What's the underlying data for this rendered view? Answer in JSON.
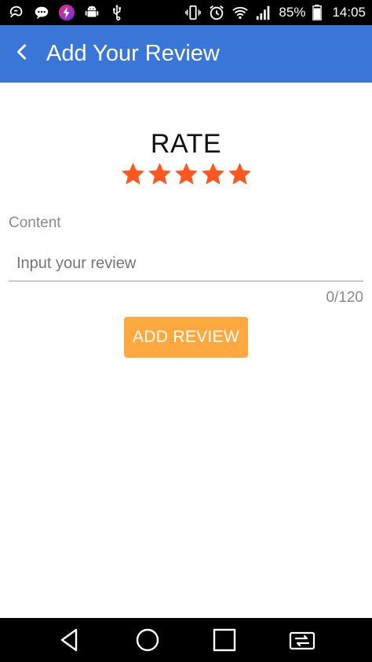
{
  "status_bar": {
    "battery_percent": "85%",
    "time": "14:05",
    "icons_left": [
      "uc-browser-icon",
      "chat-icon",
      "lightning-app-icon",
      "android-debug-icon",
      "usb-icon"
    ],
    "icons_right": [
      "vibrate-icon",
      "alarm-icon",
      "wifi-icon",
      "signal-icon",
      "battery-icon"
    ]
  },
  "app_bar": {
    "title": "Add Your Review",
    "color": "#3a75d8"
  },
  "rating": {
    "label": "RATE",
    "stars_filled": 5,
    "stars_total": 5,
    "star_color": "#fe5722"
  },
  "review": {
    "label": "Content",
    "placeholder": "Input your review",
    "value": "",
    "counter": "0/120"
  },
  "button": {
    "label": "ADD REVIEW",
    "color": "#fda940"
  },
  "nav_bar": {
    "icons": [
      "back-triangle-icon",
      "home-circle-icon",
      "recents-square-icon",
      "switch-app-icon"
    ]
  }
}
